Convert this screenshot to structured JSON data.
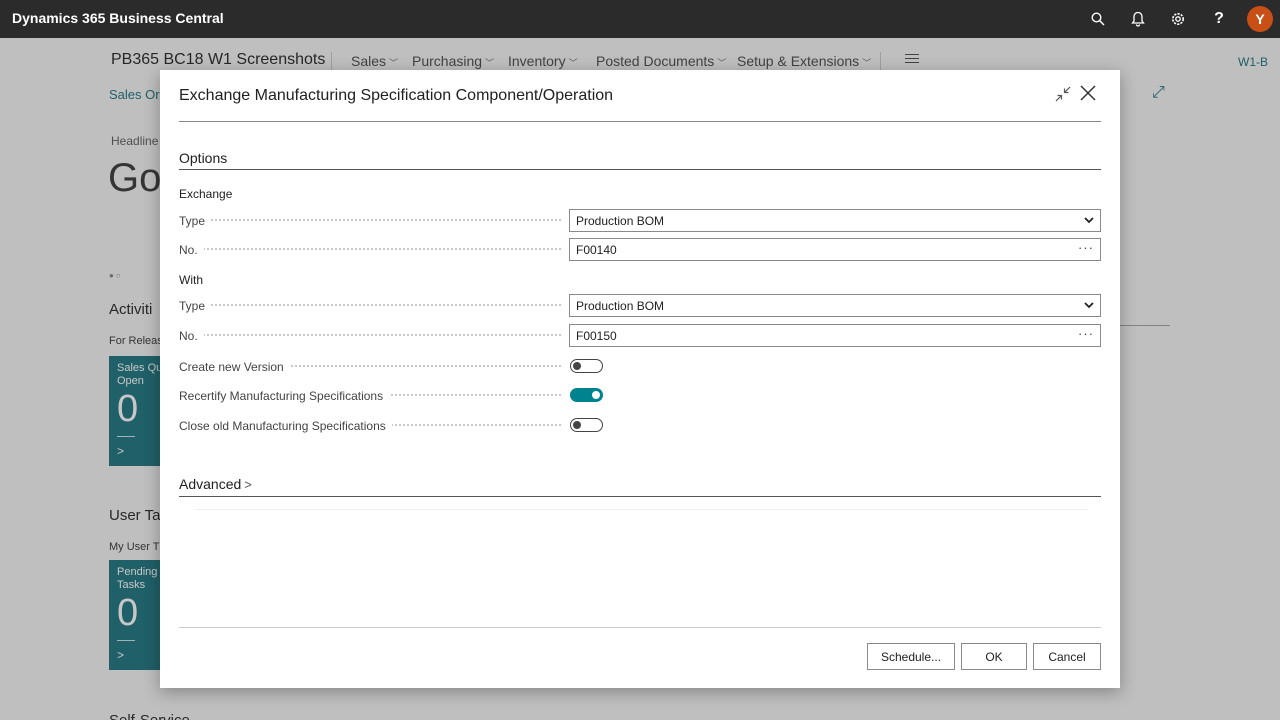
{
  "app": {
    "title": "Dynamics 365 Business Central",
    "avatar_initial": "Y"
  },
  "background": {
    "company": "PB365 BC18 W1 Screenshots",
    "nav": [
      "Sales",
      "Purchasing",
      "Inventory",
      "Posted Documents",
      "Setup & Extensions"
    ],
    "environment": "W1-B",
    "link": "Sales Orc",
    "headline_label": "Headline",
    "greeting": "Go",
    "activities_title": "Activiti",
    "activities_sub": "For Releas",
    "tile1": {
      "label_line1": "Sales Qu",
      "label_line2": "Open",
      "value": "0"
    },
    "user_tasks_title": "User Tas",
    "user_tasks_sub": "My User T",
    "tile2": {
      "label_line1": "Pending",
      "label_line2": "Tasks",
      "value": "0"
    },
    "self_service_title": "Self-Service"
  },
  "dialog": {
    "title": "Exchange Manufacturing Specification Component/Operation",
    "options_title": "Options",
    "exchange_group": "Exchange",
    "exchange_type_label": "Type",
    "exchange_type_value": "Production BOM",
    "exchange_no_label": "No.",
    "exchange_no_value": "F00140",
    "with_group": "With",
    "with_type_label": "Type",
    "with_type_value": "Production BOM",
    "with_no_label": "No.",
    "with_no_value": "F00150",
    "create_new_version_label": "Create new Version",
    "create_new_version_on": false,
    "recertify_label": "Recertify Manufacturing Specifications",
    "recertify_on": true,
    "close_old_label": "Close old Manufacturing Specifications",
    "close_old_on": false,
    "advanced_title": "Advanced",
    "schedule_label": "Schedule...",
    "ok_label": "OK",
    "cancel_label": "Cancel"
  },
  "colors": {
    "accent": "#00838f",
    "avatar": "#c84f16",
    "appbar": "#2b2b2b"
  },
  "icons": [
    "search-icon",
    "bell-icon",
    "gear-icon",
    "help-icon",
    "collapse-icon",
    "close-icon",
    "chevron-down-icon",
    "ellipsis-icon",
    "chevron-right-icon"
  ]
}
